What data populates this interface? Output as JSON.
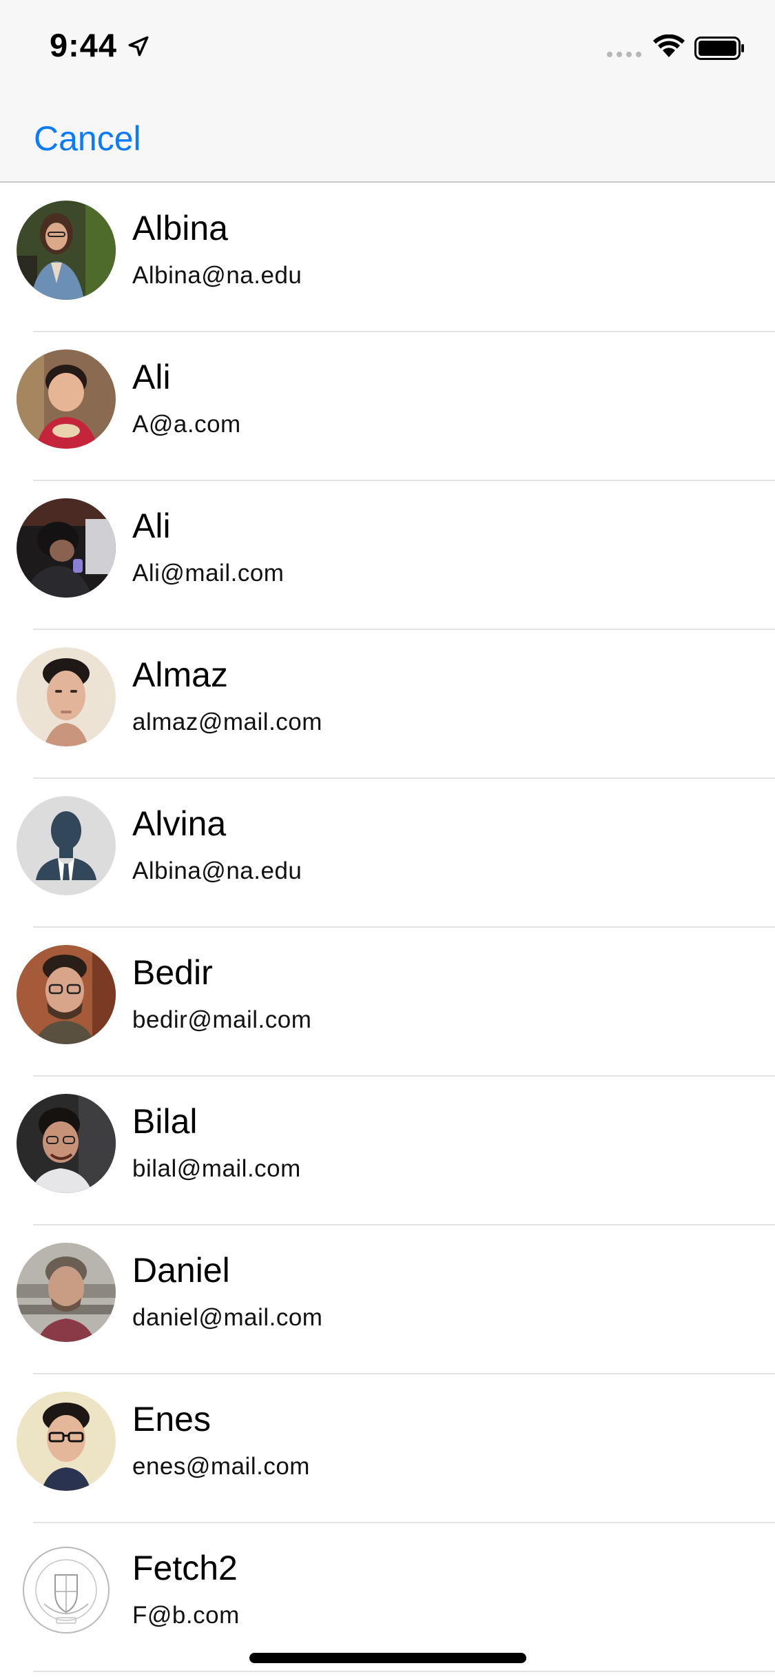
{
  "status_bar": {
    "time": "9:44"
  },
  "nav": {
    "cancel_label": "Cancel",
    "accent_color": "#0a7aff"
  },
  "contacts": [
    {
      "name": "Albina",
      "email": "Albina@na.edu",
      "avatar": "photo"
    },
    {
      "name": "Ali",
      "email": "A@a.com",
      "avatar": "photo"
    },
    {
      "name": "Ali",
      "email": "Ali@mail.com",
      "avatar": "photo"
    },
    {
      "name": "Almaz",
      "email": "almaz@mail.com",
      "avatar": "photo"
    },
    {
      "name": "Alvina",
      "email": "Albina@na.edu",
      "avatar": "default-silhouette"
    },
    {
      "name": "Bedir",
      "email": "bedir@mail.com",
      "avatar": "photo"
    },
    {
      "name": "Bilal",
      "email": "bilal@mail.com",
      "avatar": "photo"
    },
    {
      "name": "Daniel",
      "email": "daniel@mail.com",
      "avatar": "photo"
    },
    {
      "name": "Enes",
      "email": "enes@mail.com",
      "avatar": "photo"
    },
    {
      "name": "Fetch2",
      "email": "F@b.com",
      "avatar": "university-seal"
    }
  ]
}
